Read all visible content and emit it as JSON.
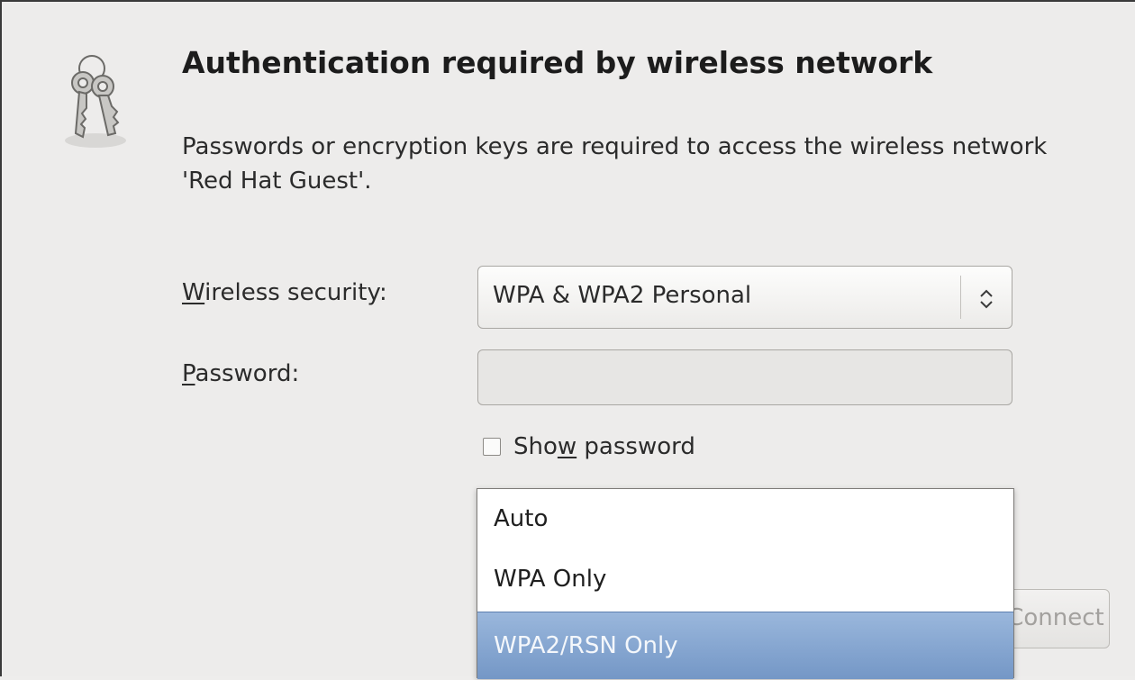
{
  "dialog": {
    "title": "Authentication required by wireless network",
    "message": "Passwords or encryption keys are required to access the wireless network 'Red Hat Guest'.",
    "icon": "keys-icon"
  },
  "form": {
    "security_label_mnemonic": "W",
    "security_label_rest": "ireless security:",
    "security_value": "WPA & WPA2 Personal",
    "password_label_mnemonic": "P",
    "password_label_rest": "assword:",
    "password_value": "",
    "show_password_pre": "Sho",
    "show_password_mnemonic": "w",
    "show_password_post": " password",
    "show_password_checked": false
  },
  "dropdown": {
    "options": [
      "Auto",
      "WPA Only",
      "WPA2/RSN Only"
    ],
    "highlighted_index": 2
  },
  "buttons": {
    "connect_label": "Connect",
    "connect_visible_label": "nect"
  },
  "colors": {
    "background": "#edeceb",
    "highlight": "#7a9cca"
  }
}
